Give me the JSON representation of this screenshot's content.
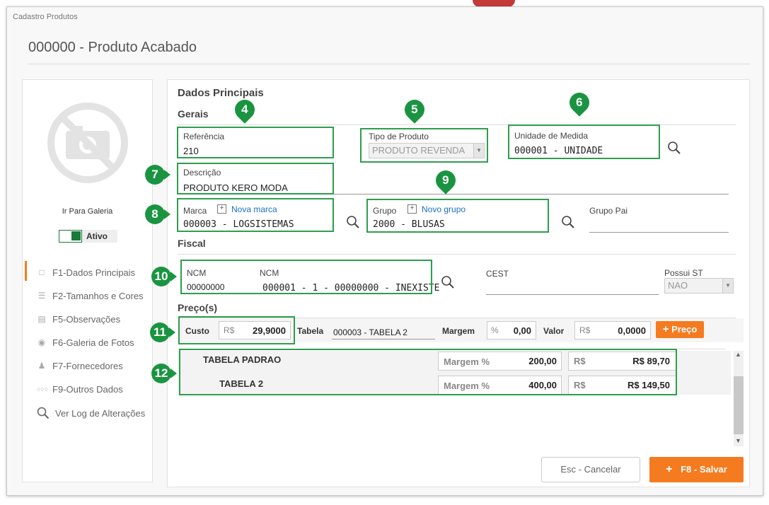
{
  "window": {
    "title": "Cadastro Produtos",
    "page_title": "000000 - Produto Acabado"
  },
  "sidebar": {
    "gallery_link": "Ir Para Galeria",
    "active_label": "Ativo",
    "items": [
      {
        "label": "F1-Dados Principais",
        "icon": "document-icon"
      },
      {
        "label": "F2-Tamanhos  e Cores",
        "icon": "list-icon"
      },
      {
        "label": "F5-Observações",
        "icon": "notes-icon"
      },
      {
        "label": "F6-Galeria de Fotos",
        "icon": "camera-icon"
      },
      {
        "label": "F7-Fornecedores",
        "icon": "supplier-icon"
      },
      {
        "label": "F9-Outros Dados",
        "icon": "dots-icon"
      },
      {
        "label": "Ver Log de Alterações",
        "icon": "search-icon"
      }
    ]
  },
  "main": {
    "section_title": "Dados Principais",
    "gerais": {
      "title": "Gerais",
      "referencia": {
        "label": "Referência",
        "value": "210"
      },
      "tipo_produto": {
        "label": "Tipo de Produto",
        "value": "PRODUTO REVENDA"
      },
      "unidade": {
        "label": "Unidade de Medida",
        "value": "000001 - UNIDADE"
      },
      "descricao": {
        "label": "Descrição",
        "value": "PRODUTO KERO MODA"
      },
      "marca": {
        "label": "Marca",
        "link": "Nova marca",
        "value": "000003 - LOGSISTEMAS"
      },
      "grupo": {
        "label": "Grupo",
        "link": "Novo grupo",
        "value": "2000 - BLUSAS"
      },
      "grupo_pai": {
        "label": "Grupo Pai",
        "value": ""
      }
    },
    "fiscal": {
      "title": "Fiscal",
      "ncm_label_1": "NCM",
      "ncm_value_1": "00000000",
      "ncm_label_2": "NCM",
      "ncm_value_2": "000001 - 1 - 00000000 - INEXISTE",
      "cest_label": "CEST",
      "possui_st_label": "Possui ST",
      "possui_st_value": "NAO"
    },
    "precos": {
      "title": "Preço(s)",
      "custo_label": "Custo",
      "currency": "R$",
      "custo_value": "29,9000",
      "tabela_label": "Tabela",
      "tabela_value": "000003 - TABELA 2",
      "margem_label": "Margem",
      "percent": "%",
      "margem_value": "0,00",
      "valor_label": "Valor",
      "valor_value": "0,0000",
      "add_button": "Preço",
      "tables": [
        {
          "name": "TABELA PADRAO",
          "margem_label": "Margem %",
          "margem": "200,00",
          "currency": "R$",
          "valor": "R$ 89,70"
        },
        {
          "name": "TABELA 2",
          "margem_label": "Margem %",
          "margem": "400,00",
          "currency": "R$",
          "valor": "R$ 149,50"
        }
      ]
    }
  },
  "footer": {
    "cancel": "Esc - Cancelar",
    "save": "F8 - Salvar"
  },
  "annotations": [
    "4",
    "5",
    "6",
    "7",
    "8",
    "9",
    "10",
    "11",
    "12"
  ],
  "colors": {
    "accent": "#f47b20",
    "highlight": "#2e9e4e",
    "badge": "#1a9440",
    "link": "#1a6fc4"
  }
}
